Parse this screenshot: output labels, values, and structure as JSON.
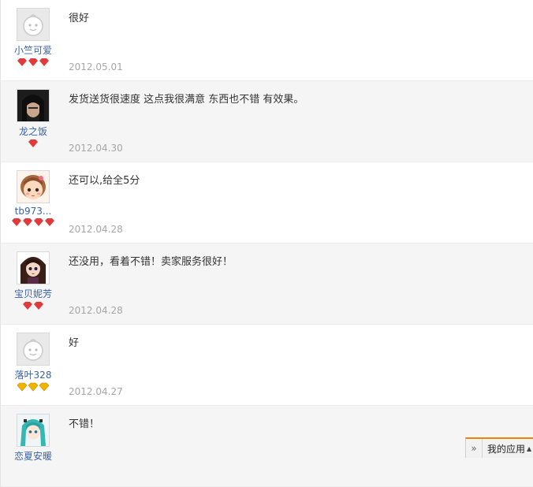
{
  "reviews": [
    {
      "username": "小竺可爱",
      "text": "很好",
      "date": "2012.05.01",
      "avatar": "default-avatar",
      "credit_count": 3,
      "credit_type": "heart",
      "credit_color": "#e03a3a"
    },
    {
      "username": "龙之饭",
      "text": "发货送货很速度 这点我很满意 东西也不错 有效果。",
      "date": "2012.04.30",
      "avatar": "dark-hair-avatar",
      "credit_count": 1,
      "credit_type": "heart",
      "credit_color": "#e03a3a"
    },
    {
      "username": "tb973...",
      "text": "还可以,给全5分",
      "date": "2012.04.28",
      "avatar": "cartoon-girl-avatar",
      "credit_count": 4,
      "credit_type": "heart",
      "credit_color": "#e03a3a"
    },
    {
      "username": "宝贝妮芳",
      "text": "还没用，看着不错！卖家服务很好！",
      "date": "2012.04.28",
      "avatar": "doll-avatar",
      "credit_count": 2,
      "credit_type": "heart",
      "credit_color": "#e03a3a"
    },
    {
      "username": "落叶328",
      "text": "好",
      "date": "2012.04.27",
      "avatar": "default-avatar",
      "credit_count": 3,
      "credit_type": "diamond",
      "credit_color": "#f0b400"
    },
    {
      "username": "恋夏安暖",
      "text": "不错！",
      "date": "",
      "avatar": "teal-hair-avatar",
      "credit_count": 0,
      "credit_type": "heart",
      "credit_color": "#e03a3a"
    }
  ],
  "appbar": {
    "expand_icon": "double-chevron-right-icon",
    "label": "我的应用",
    "caret_icon": "caret-up-icon",
    "accent": "#f08300"
  }
}
